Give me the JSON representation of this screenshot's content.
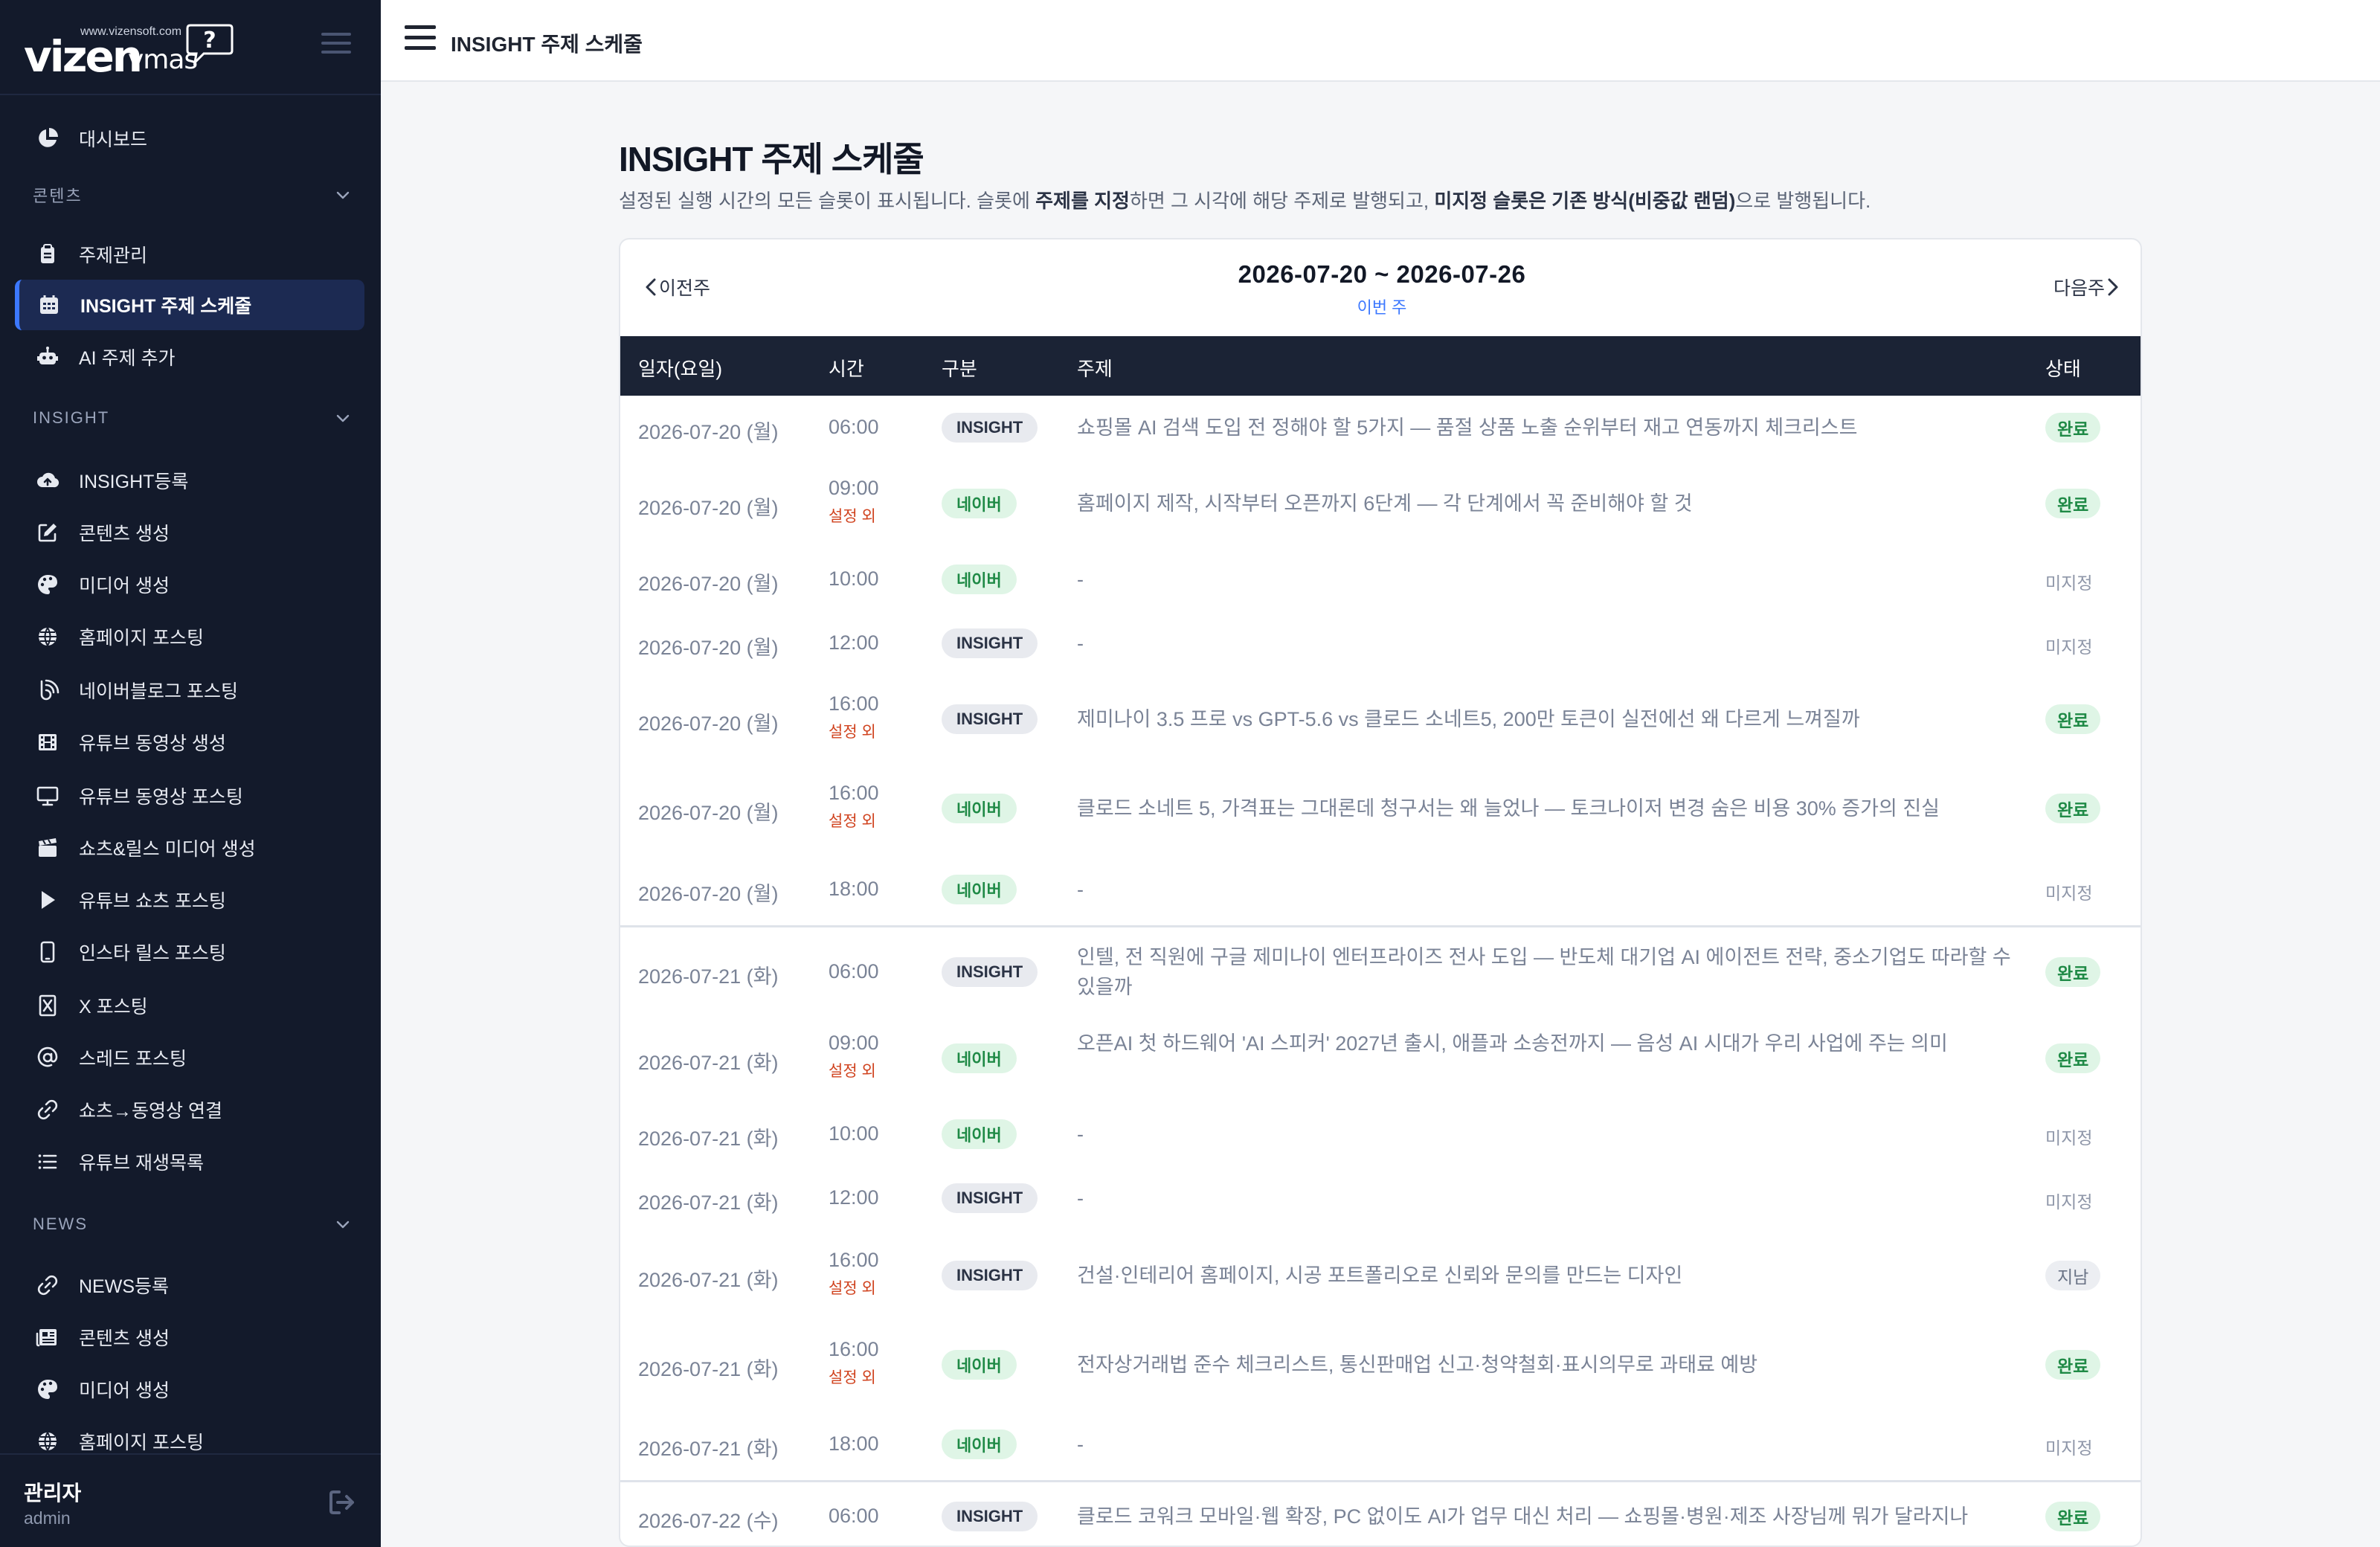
{
  "brand": {
    "url": "www.vizensoft.com",
    "word": "vizen",
    "sub": "vmas",
    "bubble": "?"
  },
  "sidebar": {
    "top_items": [
      {
        "label": "대시보드",
        "icon": "pie-chart-icon"
      }
    ],
    "sections": [
      {
        "title": "콘텐츠",
        "items": [
          {
            "label": "주제관리",
            "icon": "clipboard-icon"
          },
          {
            "label": "INSIGHT 주제 스케줄",
            "icon": "calendar-icon",
            "active": true
          },
          {
            "label": "AI 주제 추가",
            "icon": "robot-icon"
          }
        ]
      },
      {
        "title": "INSIGHT",
        "items": [
          {
            "label": "INSIGHT등록",
            "icon": "cloud-upload-icon"
          },
          {
            "label": "콘텐츠 생성",
            "icon": "edit-icon"
          },
          {
            "label": "미디어 생성",
            "icon": "palette-icon"
          },
          {
            "label": "홈페이지 포스팅",
            "icon": "globe-icon"
          },
          {
            "label": "네이버블로그 포스팅",
            "icon": "blog-icon"
          },
          {
            "label": "유튜브 동영상 생성",
            "icon": "film-icon"
          },
          {
            "label": "유튜브 동영상 포스팅",
            "icon": "monitor-icon"
          },
          {
            "label": "쇼츠&릴스 미디어 생성",
            "icon": "clapper-icon"
          },
          {
            "label": "유튜브 쇼츠 포스팅",
            "icon": "play-icon"
          },
          {
            "label": "인스타 릴스 포스팅",
            "icon": "mobile-icon"
          },
          {
            "label": "X 포스팅",
            "icon": "x-logo-icon"
          },
          {
            "label": "스레드 포스팅",
            "icon": "at-icon"
          },
          {
            "label": "쇼츠→동영상 연결",
            "icon": "link-icon"
          },
          {
            "label": "유튜브 재생목록",
            "icon": "list-icon"
          }
        ]
      },
      {
        "title": "NEWS",
        "items": [
          {
            "label": "NEWS등록",
            "icon": "link-icon"
          },
          {
            "label": "콘텐츠 생성",
            "icon": "newspaper-icon"
          },
          {
            "label": "미디어 생성",
            "icon": "palette-icon"
          },
          {
            "label": "홈페이지 포스팅",
            "icon": "globe-icon"
          }
        ]
      }
    ],
    "user": {
      "name": "관리자",
      "id": "admin"
    }
  },
  "topbar": {
    "title": "INSIGHT 주제 스케줄"
  },
  "page": {
    "title": "INSIGHT 주제 스케줄",
    "desc_1": "설정된 실행 시간의 모든 슬롯이 표시됩니다. 슬롯에 ",
    "desc_bold_1": "주제를 지정",
    "desc_2": "하면 그 시각에 해당 주제로 발행되고, ",
    "desc_bold_2": "미지정 슬롯은 기존 방식(비중값 랜덤)",
    "desc_3": "으로 발행됩니다."
  },
  "week": {
    "prev": "이전주",
    "next": "다음주",
    "range": "2026-07-20 ~ 2026-07-26",
    "this_week": "이번 주"
  },
  "table": {
    "headers": {
      "date": "일자(요일)",
      "time": "시간",
      "type": "구분",
      "topic": "주제",
      "status": "상태"
    },
    "rows": [
      {
        "date": "2026-07-20 (월)",
        "time": "06:00",
        "extra": "",
        "type": "INSIGHT",
        "topic": "쇼핑몰 AI 검색 도입 전 정해야 할 5가지 — 품절 상품 노출 순위부터 재고 연동까지 체크리스트",
        "status": "완료"
      },
      {
        "date": "2026-07-20 (월)",
        "time": "09:00",
        "extra": "설정 외",
        "type": "네이버",
        "topic": "홈페이지 제작, 시작부터 오픈까지 6단계 — 각 단계에서 꼭 준비해야 할 것",
        "status": "완료"
      },
      {
        "date": "2026-07-20 (월)",
        "time": "10:00",
        "extra": "",
        "type": "네이버",
        "topic": "-",
        "status": "미지정"
      },
      {
        "date": "2026-07-20 (월)",
        "time": "12:00",
        "extra": "",
        "type": "INSIGHT",
        "topic": "-",
        "status": "미지정"
      },
      {
        "date": "2026-07-20 (월)",
        "time": "16:00",
        "extra": "설정 외",
        "type": "INSIGHT",
        "topic": "제미나이 3.5 프로 vs GPT-5.6 vs 클로드 소네트5, 200만 토큰이 실전에선 왜 다르게 느껴질까",
        "status": "완료"
      },
      {
        "date": "2026-07-20 (월)",
        "time": "16:00",
        "extra": "설정 외",
        "type": "네이버",
        "topic": "클로드 소네트 5, 가격표는 그대론데 청구서는 왜 늘었나 — 토크나이저 변경 숨은 비용 30% 증가의 진실",
        "status": "완료"
      },
      {
        "date": "2026-07-20 (월)",
        "time": "18:00",
        "extra": "",
        "type": "네이버",
        "topic": "-",
        "status": "미지정"
      },
      {
        "date": "2026-07-21 (화)",
        "time": "06:00",
        "extra": "",
        "type": "INSIGHT",
        "topic": "인텔, 전 직원에 구글 제미나이 엔터프라이즈 전사 도입 — 반도체 대기업 AI 에이전트 전략, 중소기업도 따라할 수 있을까",
        "status": "완료"
      },
      {
        "date": "2026-07-21 (화)",
        "time": "09:00",
        "extra": "설정 외",
        "type": "네이버",
        "topic": "오픈AI 첫 하드웨어 'AI 스피커' 2027년 출시, 애플과 소송전까지 — 음성 AI 시대가 우리 사업에 주는 의미",
        "status": "완료"
      },
      {
        "date": "2026-07-21 (화)",
        "time": "10:00",
        "extra": "",
        "type": "네이버",
        "topic": "-",
        "status": "미지정"
      },
      {
        "date": "2026-07-21 (화)",
        "time": "12:00",
        "extra": "",
        "type": "INSIGHT",
        "topic": "-",
        "status": "미지정"
      },
      {
        "date": "2026-07-21 (화)",
        "time": "16:00",
        "extra": "설정 외",
        "type": "INSIGHT",
        "topic": "건설·인테리어 홈페이지, 시공 포트폴리오로 신뢰와 문의를 만드는 디자인",
        "status": "지남"
      },
      {
        "date": "2026-07-21 (화)",
        "time": "16:00",
        "extra": "설정 외",
        "type": "네이버",
        "topic": "전자상거래법 준수 체크리스트, 통신판매업 신고·청약철회·표시의무로 과태료 예방",
        "status": "완료"
      },
      {
        "date": "2026-07-21 (화)",
        "time": "18:00",
        "extra": "",
        "type": "네이버",
        "topic": "-",
        "status": "미지정"
      },
      {
        "date": "2026-07-22 (수)",
        "time": "06:00",
        "extra": "",
        "type": "INSIGHT",
        "topic": "클로드 코워크 모바일·웹 확장, PC 없이도 AI가 업무 대신 처리 — 쇼핑몰·병원·제조 사장님께 뭐가 달라지나",
        "status": "완료"
      }
    ]
  },
  "colors": {
    "sidebar_bg": "#131a2b",
    "accent": "#3c78ff",
    "done_green": "#1f8a46",
    "extra_red": "#d0431f",
    "table_header": "#1b2335"
  }
}
